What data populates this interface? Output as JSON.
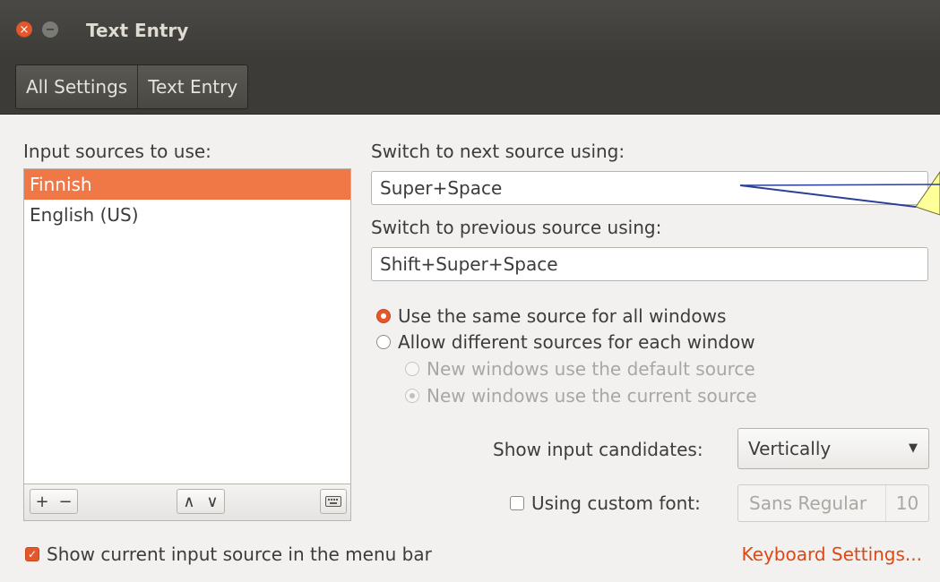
{
  "window": {
    "title": "Text Entry",
    "close_glyph": "×",
    "minimize_glyph": "−"
  },
  "toolbar": {
    "crumbs": [
      "All Settings",
      "Text Entry"
    ]
  },
  "left": {
    "heading": "Input sources to use:",
    "sources": [
      "Finnish",
      "English (US)"
    ],
    "selected_index": 0,
    "buttons": {
      "add": "+",
      "remove": "−",
      "up": "∧",
      "down": "∨"
    }
  },
  "right": {
    "next_label": "Switch to next source using:",
    "next_value": "Super+Space",
    "prev_label": "Switch to previous source using:",
    "prev_value": "Shift+Super+Space",
    "radio_same": "Use the same source for all windows",
    "radio_different": "Allow different sources for each window",
    "sub_default": "New windows use the default source",
    "sub_current": "New windows use the current source",
    "candidates_label": "Show input candidates:",
    "candidates_value": "Vertically",
    "custom_font_label": "Using custom font:",
    "font_name": "Sans Regular",
    "font_size": "10"
  },
  "footer": {
    "show_menu_label": "Show current input source in the menu bar",
    "show_menu_checked": true,
    "keyboard_link": "Keyboard Settings..."
  },
  "colors": {
    "accent": "#f07746",
    "link": "#dd4814",
    "callout_fill": "#ffff99"
  }
}
